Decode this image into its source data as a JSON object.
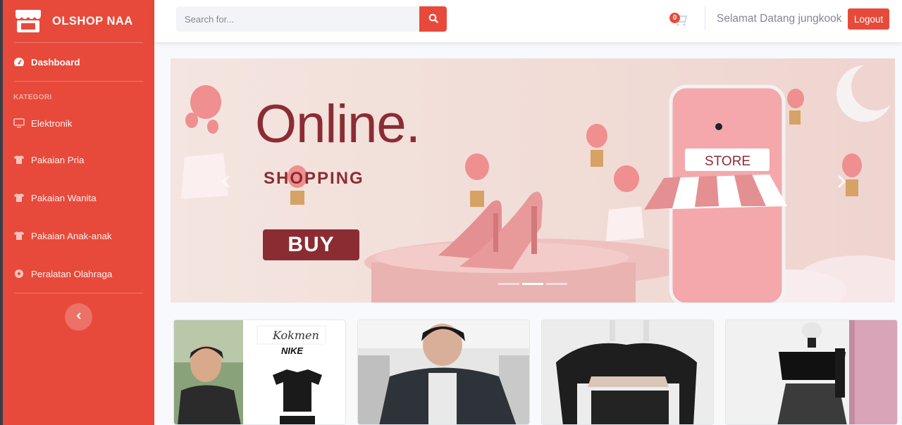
{
  "brand": {
    "name": "OLSHOP NAA",
    "icon": "store-icon"
  },
  "sidebar": {
    "dashboard": {
      "label": "Dashboard",
      "icon": "tachometer-icon"
    },
    "heading": "KATEGORI",
    "categories": [
      {
        "label": "Elektronik",
        "icon": "desktop-icon"
      },
      {
        "label": "Pakaian Pria",
        "icon": "tshirt-icon"
      },
      {
        "label": "Pakaian Wanita",
        "icon": "tshirt-icon"
      },
      {
        "label": "Pakaian Anak-anak",
        "icon": "tshirt-icon"
      },
      {
        "label": "Peralatan Olahraga",
        "icon": "futbol-icon"
      }
    ],
    "toggle_icon": "chevron-left-icon"
  },
  "topbar": {
    "search_placeholder": "Search for...",
    "cart_count": "0",
    "welcome": "Selamat Datang jungkook",
    "logout_label": "Logout"
  },
  "banner": {
    "title": "Online.",
    "subtitle": "SHOPPING",
    "button": "BUY",
    "store_sign": "STORE",
    "slides": 3,
    "active_slide": 2
  },
  "products": [
    {
      "brand_tag": "Kokmen",
      "logo": "NIKE"
    },
    {
      "brand_tag": ""
    },
    {
      "brand_tag": ""
    },
    {
      "brand_tag": ""
    }
  ],
  "colors": {
    "primary": "#e74a3b",
    "banner_text": "#8b2c33",
    "background": "#f8f9fc"
  }
}
